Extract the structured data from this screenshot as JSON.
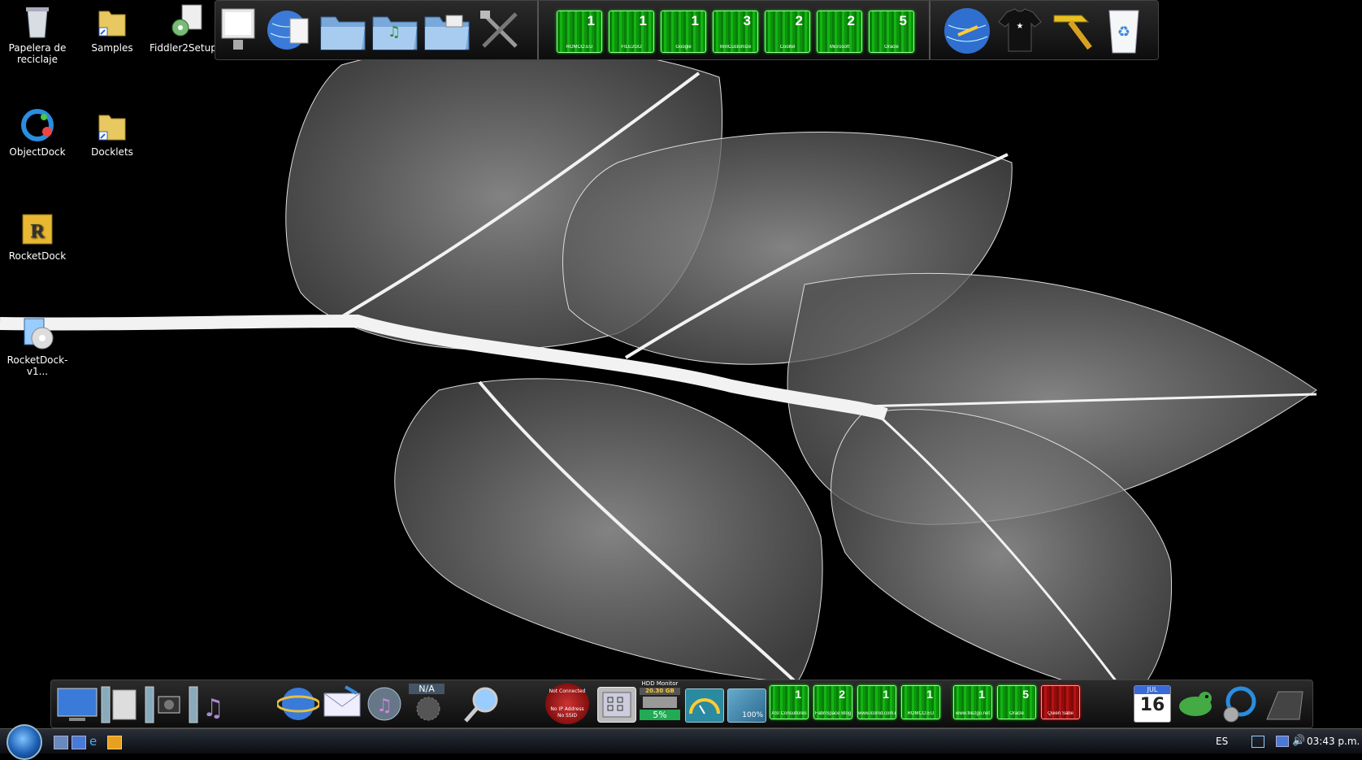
{
  "desktop_icons": [
    {
      "label": "Papelera de reciclaje",
      "icon": "recycle-bin-icon"
    },
    {
      "label": "Samples",
      "icon": "folder-shortcut-icon"
    },
    {
      "label": "Fiddler2Setup....",
      "icon": "installer-icon"
    },
    {
      "label": "ObjectDock",
      "icon": "objectdock-icon"
    },
    {
      "label": "Docklets",
      "icon": "folder-shortcut-icon"
    },
    {
      "label": "RocketDock",
      "icon": "rocketdock-icon"
    },
    {
      "label": "RocketDock-v1...",
      "icon": "setup-disc-icon"
    }
  ],
  "top_dock": {
    "left_icons": [
      "monitor-icon",
      "globe-document-icon",
      "folder-icon",
      "music-folder-icon",
      "pictures-folder-icon",
      "tools-icon"
    ],
    "tiles": [
      {
        "count": "1",
        "label": "ROMCO.EU"
      },
      {
        "count": "1",
        "label": "FILE2GO"
      },
      {
        "count": "1",
        "label": "Google"
      },
      {
        "count": "3",
        "label": "WinCustomize"
      },
      {
        "count": "2",
        "label": "Cooltel"
      },
      {
        "count": "2",
        "label": "Microsoft"
      },
      {
        "count": "5",
        "label": "Oracle"
      }
    ],
    "right_icons": [
      "globe-network-icon",
      "tshirt-icon",
      "hammer-icon",
      "recycle-bin-icon"
    ]
  },
  "bottom_dock": {
    "left_icons": [
      "desktop-icon",
      "documents-icon",
      "pictures-icon",
      "music-icon"
    ],
    "mid_icons": [
      "internet-explorer-icon",
      "mail-icon",
      "media-player-icon"
    ],
    "weather_text": "N/A",
    "wifi_widget": {
      "line1": "Not Connected",
      "line2": "No IP Address",
      "line3": "No SSID"
    },
    "hdd_monitor": {
      "title": "HDD Monitor",
      "free": "20.30 GB",
      "percent": "5%"
    },
    "battery_text": "100%",
    "tiles": [
      {
        "count": "1",
        "label": "ASI Consultores"
      },
      {
        "count": "2",
        "label": "FabriSpace Blog"
      },
      {
        "count": "1",
        "label": "www.lcomd.com.mx"
      },
      {
        "count": "1",
        "label": "ROMCO.EU"
      },
      {
        "count": "1",
        "label": "www.file2go.net"
      },
      {
        "count": "5",
        "label": "Oracle"
      }
    ],
    "red_tile": {
      "label": "Quien Sabe"
    },
    "calendar": {
      "month": "JUL",
      "day": "16"
    },
    "right_icons": [
      "gecko-icon",
      "objectdock-settings-icon",
      "dock-icon"
    ]
  },
  "taskbar": {
    "language": "ES",
    "clock": "03:43 p.m.",
    "quick_launch": [
      "show-desktop-icon",
      "switch-windows-icon",
      "ie-icon",
      "media-icon"
    ]
  },
  "colors": {
    "tile_green": "#13b513",
    "tile_red": "#b51313",
    "background": "#000000"
  }
}
